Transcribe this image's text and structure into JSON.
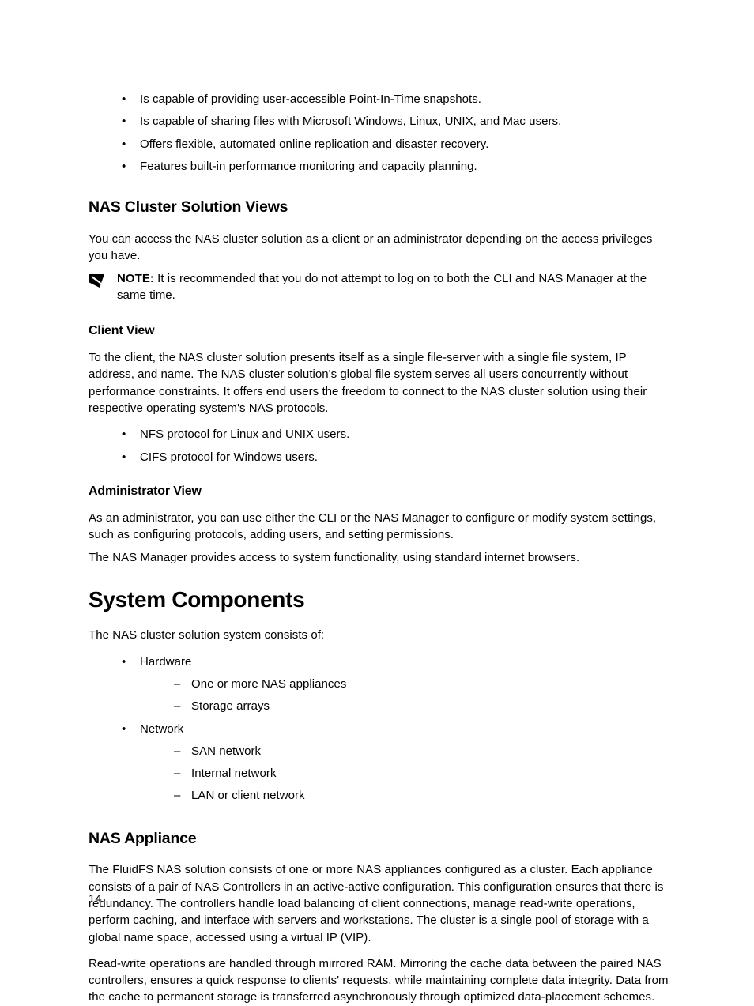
{
  "top_bullets": [
    "Is capable of providing user-accessible Point-In-Time snapshots.",
    "Is capable of sharing files with Microsoft Windows, Linux, UNIX, and Mac users.",
    "Offers flexible, automated online replication and disaster recovery.",
    "Features built-in performance monitoring and capacity planning."
  ],
  "views": {
    "heading": "NAS Cluster Solution Views",
    "intro": "You can access the NAS cluster solution as a client or an administrator depending on the access privileges you have.",
    "note_label": "NOTE: ",
    "note_body": "It is recommended that you do not attempt to log on to both the CLI and NAS Manager at the same time.",
    "client": {
      "heading": "Client View",
      "para": "To the client, the NAS cluster solution presents itself as a single file-server with a single file system, IP address, and name. The NAS cluster solution's global file system serves all users concurrently without performance constraints. It offers end users the freedom to connect to the NAS cluster solution using their respective operating system's NAS protocols.",
      "bullets": [
        "NFS protocol for Linux and UNIX users.",
        "CIFS protocol for Windows users."
      ]
    },
    "admin": {
      "heading": "Administrator View",
      "para1": "As an administrator, you can use either the CLI or the NAS Manager to configure or modify system settings, such as configuring protocols, adding users, and setting permissions.",
      "para2": "The NAS Manager provides access to system functionality, using standard internet browsers."
    }
  },
  "components": {
    "heading": "System Components",
    "intro": "The NAS cluster solution system consists of:",
    "items": [
      {
        "label": "Hardware",
        "children": [
          "One or more NAS appliances",
          "Storage arrays"
        ]
      },
      {
        "label": "Network",
        "children": [
          "SAN network",
          "Internal network",
          "LAN or client network"
        ]
      }
    ]
  },
  "appliance": {
    "heading": "NAS Appliance",
    "para1": "The FluidFS NAS solution consists of one or more NAS appliances configured as a cluster. Each appliance consists of a pair of NAS Controllers in an active-active configuration. This configuration ensures that there is redundancy. The controllers handle load balancing of client connections, manage read-write operations, perform caching, and interface with servers and workstations. The cluster is a single pool of storage with a global name space, accessed using a virtual IP (VIP).",
    "para2": "Read-write operations are handled through mirrored RAM. Mirroring the cache data between the paired NAS controllers, ensures a quick response to clients' requests, while maintaining complete data integrity. Data from the cache to permanent storage is transferred asynchronously through optimized data-placement schemes."
  },
  "page_number": "14"
}
